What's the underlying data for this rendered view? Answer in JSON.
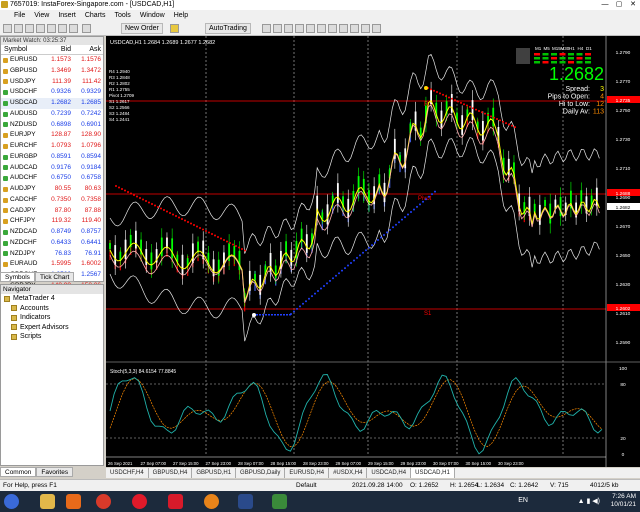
{
  "window": {
    "title": "7657019: InstaForex-Singapore.com - [USDCAD,H1]",
    "controls": [
      "—",
      "▢",
      "✕"
    ]
  },
  "menu": [
    "File",
    "View",
    "Insert",
    "Charts",
    "Tools",
    "Window",
    "Help"
  ],
  "toolbar": {
    "new_order": "New Order",
    "autotrading": "AutoTrading"
  },
  "market_watch": {
    "title": "Market Watch: 03:25:37",
    "headers": [
      "Symbol",
      "Bid",
      "Ask"
    ],
    "rows": [
      {
        "symbol": "EURUSD",
        "bid": "1.1573",
        "ask": "1.1576",
        "dir": "down"
      },
      {
        "symbol": "GBPUSD",
        "bid": "1.3469",
        "ask": "1.3472",
        "dir": "down"
      },
      {
        "symbol": "USDJPY",
        "bid": "111.39",
        "ask": "111.42",
        "dir": "down"
      },
      {
        "symbol": "USDCHF",
        "bid": "0.9326",
        "ask": "0.9329",
        "dir": "up"
      },
      {
        "symbol": "USDCAD",
        "bid": "1.2682",
        "ask": "1.2685",
        "dir": "up"
      },
      {
        "symbol": "AUDUSD",
        "bid": "0.7239",
        "ask": "0.7242",
        "dir": "up"
      },
      {
        "symbol": "NZDUSD",
        "bid": "0.6898",
        "ask": "0.6901",
        "dir": "up"
      },
      {
        "symbol": "EURJPY",
        "bid": "128.87",
        "ask": "128.90",
        "dir": "down"
      },
      {
        "symbol": "EURCHF",
        "bid": "1.0793",
        "ask": "1.0796",
        "dir": "down"
      },
      {
        "symbol": "EURGBP",
        "bid": "0.8591",
        "ask": "0.8594",
        "dir": "up"
      },
      {
        "symbol": "AUDCAD",
        "bid": "0.9176",
        "ask": "0.9184",
        "dir": "up"
      },
      {
        "symbol": "AUDCHF",
        "bid": "0.6750",
        "ask": "0.6758",
        "dir": "up"
      },
      {
        "symbol": "AUDJPY",
        "bid": "80.55",
        "ask": "80.63",
        "dir": "down"
      },
      {
        "symbol": "CADCHF",
        "bid": "0.7350",
        "ask": "0.7358",
        "dir": "down"
      },
      {
        "symbol": "CADJPY",
        "bid": "87.80",
        "ask": "87.88",
        "dir": "down"
      },
      {
        "symbol": "CHFJPY",
        "bid": "119.32",
        "ask": "119.40",
        "dir": "down"
      },
      {
        "symbol": "NZDCAD",
        "bid": "0.8749",
        "ask": "0.8757",
        "dir": "up"
      },
      {
        "symbol": "NZDCHF",
        "bid": "0.6433",
        "ask": "0.6441",
        "dir": "up"
      },
      {
        "symbol": "NZDJPY",
        "bid": "76.83",
        "ask": "76.91",
        "dir": "up"
      },
      {
        "symbol": "EURAUD",
        "bid": "1.5995",
        "ask": "1.6002",
        "dir": "down"
      },
      {
        "symbol": "GBPCHF",
        "bid": "1.2560",
        "ask": "1.2567",
        "dir": "up"
      },
      {
        "symbol": "GBPJPY",
        "bid": "149.99",
        "ask": "150.06",
        "dir": "down"
      }
    ],
    "tabs": [
      "Symbols",
      "Tick Chart"
    ]
  },
  "navigator": {
    "title": "Navigator",
    "items": [
      "MetaTrader 4",
      "Accounts",
      "Indicators",
      "Expert Advisors",
      "Scripts"
    ],
    "tabs": [
      "Common",
      "Favorites"
    ]
  },
  "chart": {
    "header": "USDCAD,H1  1.2684 1.2689 1.2677 1.2682",
    "levels": [
      "R4 1.2940",
      "R3 1.2848",
      "R2 1.2802",
      "R1 1.2755",
      "Pivot 1.2709",
      "S1 1.2617",
      "S2 1.2566",
      "S3 1.2484",
      "S4 1.2441"
    ],
    "info_panel": {
      "timeframes": [
        "M1",
        "M5",
        "M15",
        "M30",
        "H1",
        "H4",
        "D1"
      ],
      "price": "1.2682",
      "lines": [
        {
          "label": "Spread:",
          "value": "3"
        },
        {
          "label": "Pips to Open:",
          "value": "4"
        },
        {
          "label": "Hi to Low:",
          "value": "12"
        },
        {
          "label": "Daily Av:",
          "value": "113"
        }
      ]
    },
    "price_axis": [
      "1.2790",
      "1.2770",
      "1.2750",
      "1.2730",
      "1.2710",
      "1.2690",
      "1.2670",
      "1.2650",
      "1.2630",
      "1.2610",
      "1.2590"
    ],
    "price_tags": [
      {
        "text": "1.2735",
        "kind": "red"
      },
      {
        "text": "1.2688",
        "kind": "red"
      },
      {
        "text": "1.2682",
        "kind": "current"
      },
      {
        "text": "1.2602",
        "kind": "red"
      }
    ],
    "hline_labels": [
      "R1",
      "Pivot",
      "S1"
    ],
    "stoch": {
      "header": "Stoch(5,3,3) 84.6154 77.8845",
      "axis": [
        "100",
        "80",
        "20",
        "0"
      ]
    },
    "time_axis": [
      "26 Sep 2021",
      "27 Sep 07:00",
      "27 Sep 15:00",
      "27 Sep 23:00",
      "28 Sep 07:00",
      "28 Sep 15:00",
      "28 Sep 23:00",
      "29 Sep 07:00",
      "29 Sep 15:00",
      "29 Sep 23:00",
      "30 Sep 07:00",
      "30 Sep 15:00",
      "30 Sep 23:00"
    ]
  },
  "chart_tabs": [
    "USDCHF,H4",
    "GBPUSD,H4",
    "GBPUSD,H1",
    "GBPUSD,Daily",
    "EURUSD,H4",
    "#USDX,H4",
    "USDCAD,H4",
    "USDCAD,H1"
  ],
  "active_chart_tab": "USDCAD,H1",
  "status": {
    "help": "For Help, press F1",
    "profile": "Default",
    "datetime": "2021.09.28 14:00",
    "open": "O: 1.2652",
    "high": "H: 1.2654",
    "low": "L: 1.2634",
    "close": "C: 1.2642",
    "volume": "V: 715",
    "traffic": "4012/5 kb"
  },
  "taskbar": {
    "lang": "EN",
    "time": "7:26 AM",
    "date": "10/01/21",
    "apps": [
      "start",
      "explorer",
      "media",
      "chrome",
      "opera",
      "vivaldi",
      "firefox",
      "terminal",
      "metatrader"
    ]
  },
  "colors": {
    "bull_candle": "#00ff00",
    "bear_candle": "#ffffff",
    "red_line": "#ff0000",
    "yellow_line": "#ffff00",
    "blue_fill": "#4a6cff",
    "price_green": "#00ff00",
    "up_tick": "#1a3ee8",
    "down_tick": "#e01818",
    "taskbar": "#1c2a3c"
  }
}
